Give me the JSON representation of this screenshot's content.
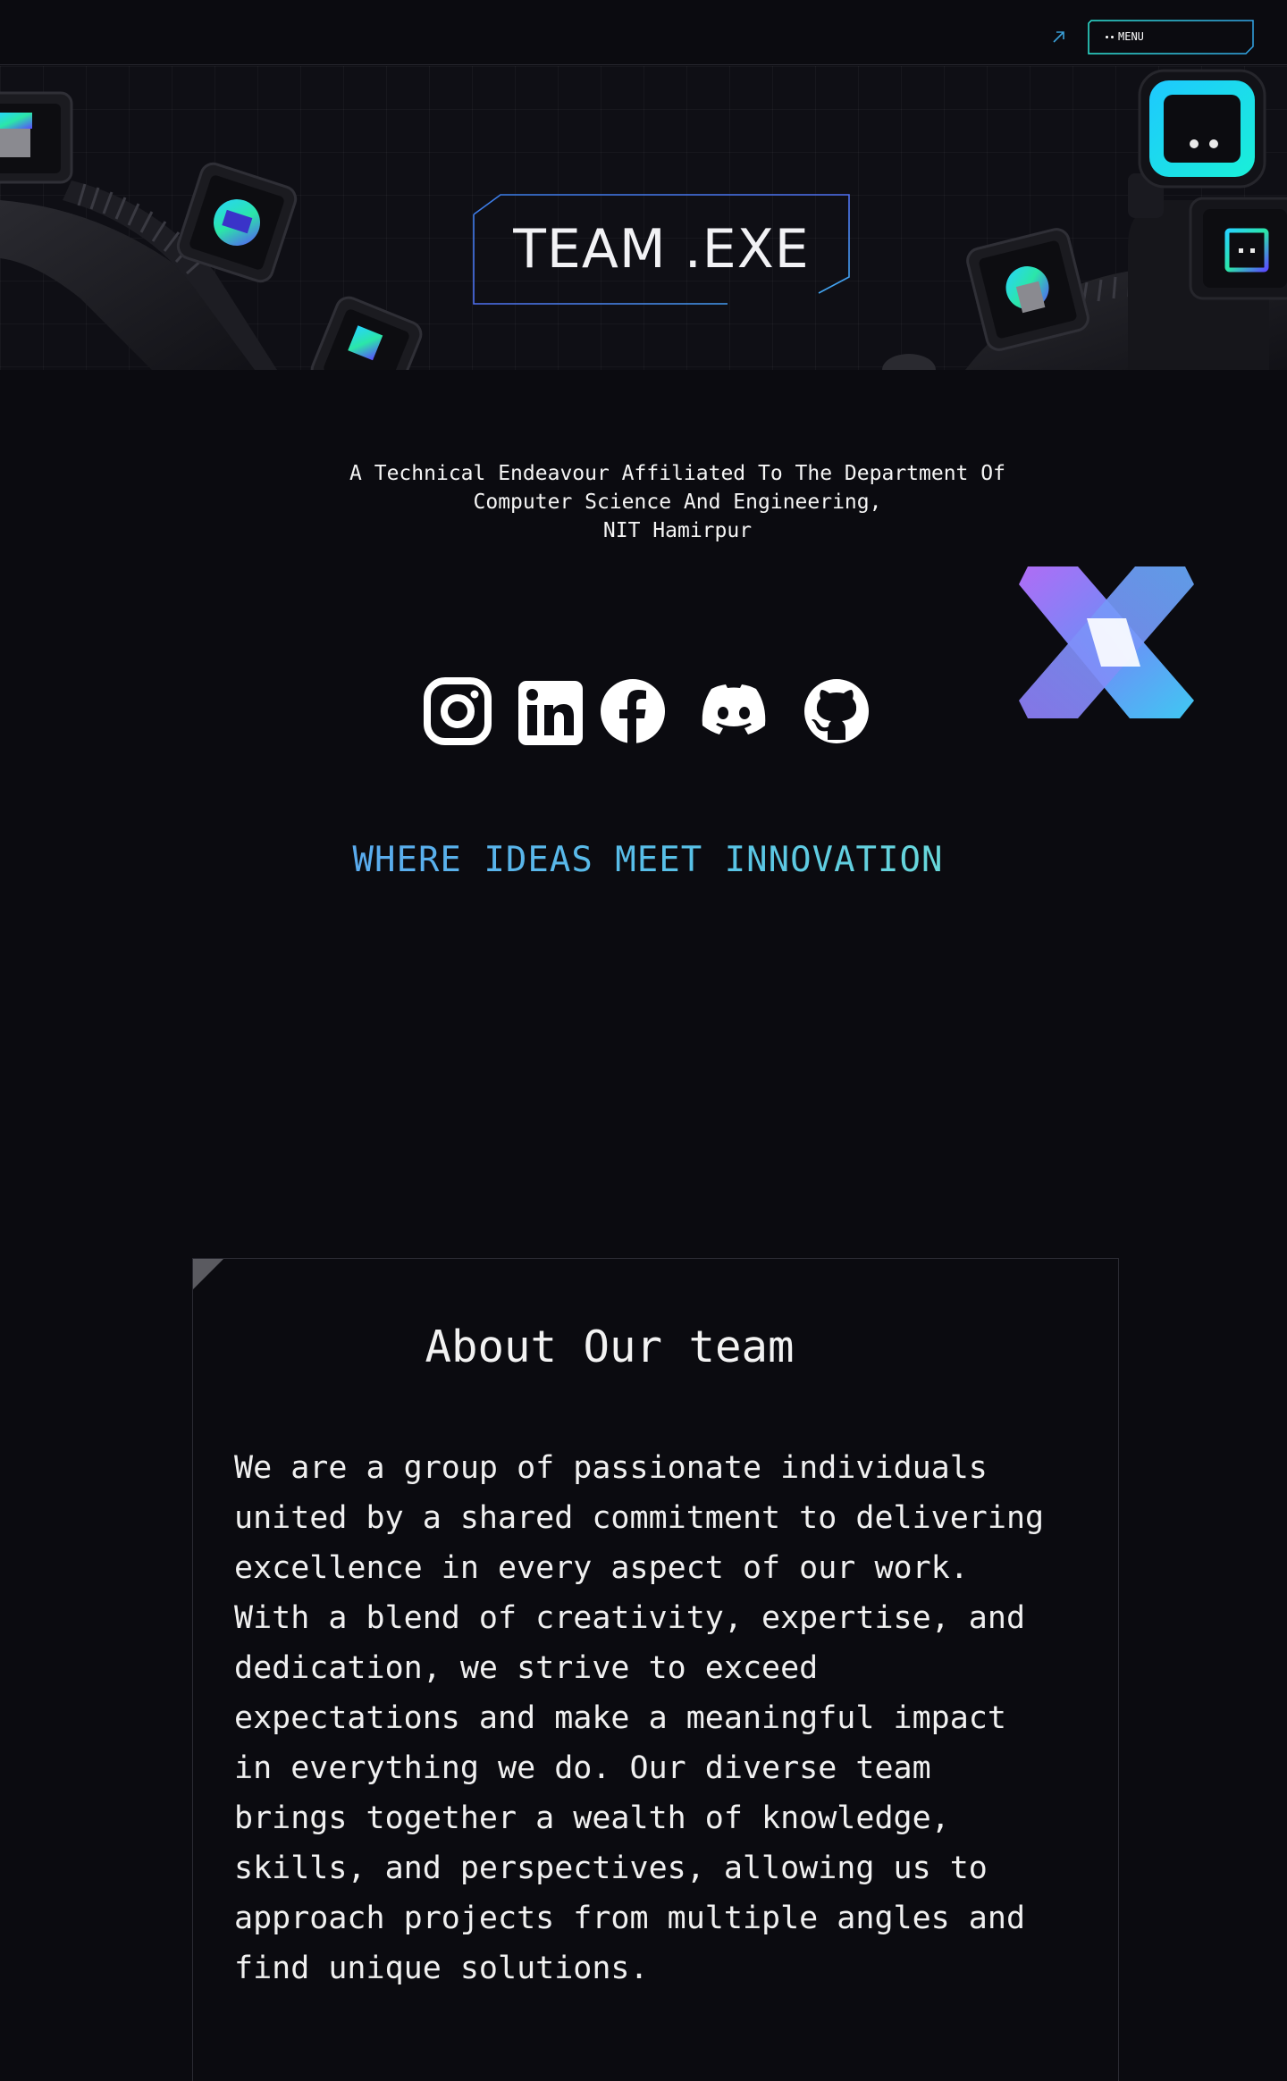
{
  "nav": {
    "menu_label": "MENU",
    "external_link_icon": "arrow-up-right-icon"
  },
  "hero": {
    "title": "TEAM .EXE"
  },
  "affiliation": {
    "line1": "A Technical Endeavour Affiliated To The Department Of",
    "line2": "Computer Science And Engineering,",
    "line3": "NIT Hamirpur"
  },
  "socials": [
    {
      "name": "instagram-icon"
    },
    {
      "name": "linkedin-icon"
    },
    {
      "name": "facebook-icon"
    },
    {
      "name": "discord-icon"
    },
    {
      "name": "github-icon"
    }
  ],
  "tagline": "WHERE IDEAS MEET INNOVATION",
  "about": {
    "title": "About Our team",
    "lines": [
      "We are a group of passionate individuals",
      "united by a shared commitment to delivering",
      "excellence in every aspect of our work.",
      "With a blend of creativity, expertise, and",
      "dedication, we strive to exceed",
      "expectations and make a meaningful impact",
      "in everything we do. Our diverse team",
      "brings together a wealth of knowledge,",
      "skills, and perspectives, allowing us to",
      "approach projects from multiple angles and",
      "find unique solutions."
    ]
  },
  "colors": {
    "background": "#0b0b10",
    "accent_teal": "#2ee6d6",
    "accent_blue": "#3f7ff0",
    "tagline_blue": "#5aa5f0"
  }
}
